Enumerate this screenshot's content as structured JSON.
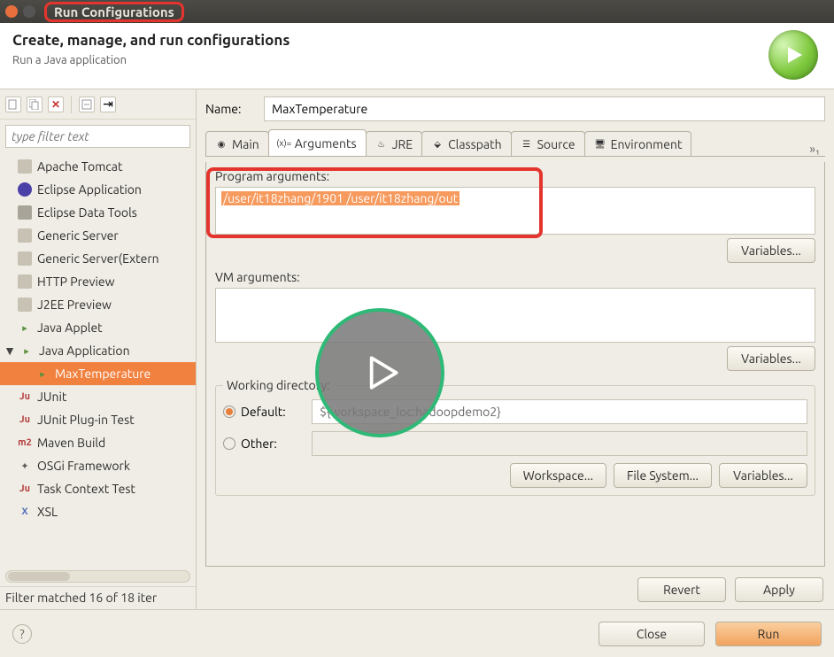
{
  "window_title": "Run Configurations",
  "header": {
    "title": "Create, manage, and run configurations",
    "subtitle": "Run a Java application"
  },
  "left": {
    "filter_placeholder": "type filter text",
    "items": [
      {
        "label": "Apache Tomcat",
        "icon": "server"
      },
      {
        "label": "Eclipse Application",
        "icon": "eclipse"
      },
      {
        "label": "Eclipse Data Tools",
        "icon": "db"
      },
      {
        "label": "Generic Server",
        "icon": "server"
      },
      {
        "label": "Generic Server(Extern",
        "icon": "server"
      },
      {
        "label": "HTTP Preview",
        "icon": "server"
      },
      {
        "label": "J2EE Preview",
        "icon": "server"
      },
      {
        "label": "Java Applet",
        "icon": "applet"
      },
      {
        "label": "Java Application",
        "icon": "java",
        "expanded": true
      },
      {
        "label": "MaxTemperature",
        "icon": "java",
        "child": true,
        "selected": true
      },
      {
        "label": "JUnit",
        "icon": "junit"
      },
      {
        "label": "JUnit Plug-in Test",
        "icon": "junit"
      },
      {
        "label": "Maven Build",
        "icon": "maven"
      },
      {
        "label": "OSGi Framework",
        "icon": "osgi"
      },
      {
        "label": "Task Context Test",
        "icon": "junit"
      },
      {
        "label": "XSL",
        "icon": "xsl"
      }
    ],
    "filter_status": "Filter matched 16 of 18 iter"
  },
  "right": {
    "name_label": "Name:",
    "name_value": "MaxTemperature",
    "tabs": [
      "Main",
      "Arguments",
      "JRE",
      "Classpath",
      "Source",
      "Environment"
    ],
    "active_tab": "Arguments",
    "overflow": "»₁",
    "program_args_label": "Program arguments:",
    "program_args_value": "/user/it18zhang/1901 /user/it18zhang/out",
    "vm_args_label": "VM arguments:",
    "vm_args_value": "",
    "variables_btn": "Variables...",
    "wd_legend": "Working directory:",
    "wd_default_label": "Default:",
    "wd_other_label": "Other:",
    "wd_default_value": "${workspace_loc:hadoopdemo2}",
    "wd_btns": [
      "Workspace...",
      "File System...",
      "Variables..."
    ],
    "revert": "Revert",
    "apply": "Apply"
  },
  "footer": {
    "close": "Close",
    "run": "Run"
  }
}
